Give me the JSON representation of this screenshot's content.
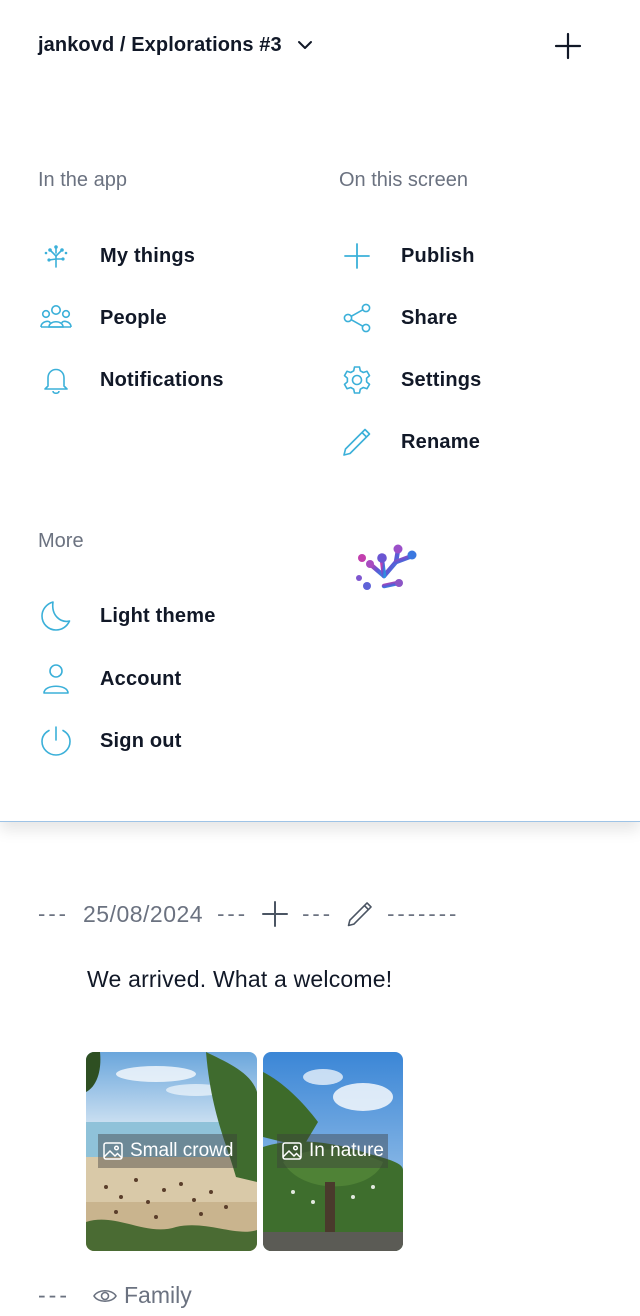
{
  "header": {
    "breadcrumb": "jankovd / Explorations #3"
  },
  "sections": {
    "in_the_app": {
      "title": "In the app",
      "items": [
        {
          "label": "My things",
          "icon": "branch-logo-icon"
        },
        {
          "label": "People",
          "icon": "people-icon"
        },
        {
          "label": "Notifications",
          "icon": "bell-icon"
        }
      ]
    },
    "on_this_screen": {
      "title": "On this screen",
      "items": [
        {
          "label": "Publish",
          "icon": "plus-icon"
        },
        {
          "label": "Share",
          "icon": "share-icon"
        },
        {
          "label": "Settings",
          "icon": "gear-icon"
        },
        {
          "label": "Rename",
          "icon": "pencil-icon"
        }
      ]
    },
    "more": {
      "title": "More",
      "items": [
        {
          "label": "Light theme",
          "icon": "moon-icon"
        },
        {
          "label": "Account",
          "icon": "user-icon"
        },
        {
          "label": "Sign out",
          "icon": "power-icon"
        }
      ]
    }
  },
  "entry": {
    "date": "25/08/2024",
    "dashes_left": "---",
    "dashes_mid1": "---",
    "dashes_mid2": "---",
    "dashes_right": "-------",
    "text": "We arrived. What a welcome!",
    "photos": [
      {
        "label": "Small crowd"
      },
      {
        "label": "In nature"
      }
    ],
    "visibility_dashes": "---",
    "visibility": "Family"
  },
  "colors": {
    "accent": "#3bb0d9",
    "text": "#111827",
    "muted": "#6b7280"
  }
}
